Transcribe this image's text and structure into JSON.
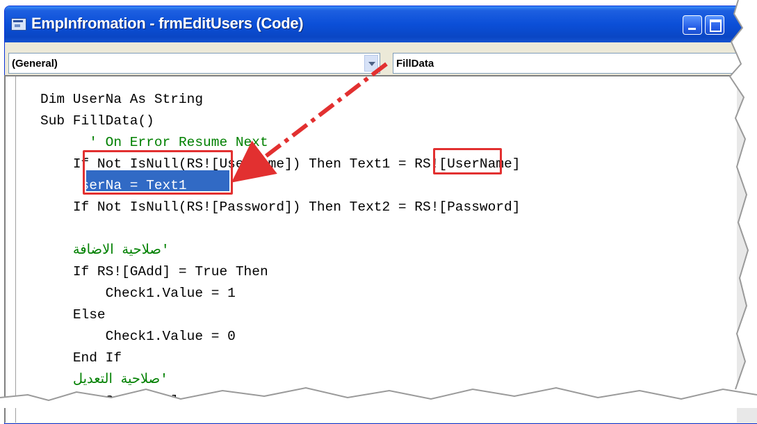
{
  "window": {
    "title": "EmpInfromation - frmEditUsers (Code)"
  },
  "comboboxes": {
    "object": "(General)",
    "procedure": "FillData"
  },
  "code_lines": [
    {
      "indent": "",
      "text": "Dim UserNa As String"
    },
    {
      "indent": "",
      "text": "Sub FillData()"
    },
    {
      "indent": "      ",
      "text": "' On Error Resume Next",
      "comment": true
    },
    {
      "indent": "    ",
      "text": "If Not IsNull(RS![UserName]) Then Text1 = RS![UserName]"
    },
    {
      "indent": "    ",
      "text": "UserNa = Text1",
      "selected": true
    },
    {
      "indent": "    ",
      "text": "If Not IsNull(RS![Password]) Then Text2 = RS![Password]"
    },
    {
      "indent": "",
      "text": ""
    },
    {
      "indent": "    ",
      "text": "'صلاحية الاضافة",
      "comment": true
    },
    {
      "indent": "    ",
      "text": "If RS![GAdd] = True Then"
    },
    {
      "indent": "        ",
      "text": "Check1.Value = 1"
    },
    {
      "indent": "    ",
      "text": "Else"
    },
    {
      "indent": "        ",
      "text": "Check1.Value = 0"
    },
    {
      "indent": "    ",
      "text": "End If"
    },
    {
      "indent": "    ",
      "text": "'صلاحية التعديل",
      "comment": true
    },
    {
      "indent": "    ",
      "text": "If RS![GEdit] = True Then"
    }
  ],
  "colors": {
    "titlebar": "#0b4fd8",
    "selection": "#316ac5",
    "comment": "#008000",
    "annotation": "#e23030"
  },
  "icons": {
    "window": "vb-code-window-icon",
    "minimize": "minimize-icon",
    "maximize": "maximize-icon",
    "dropdown": "chevron-down-icon"
  }
}
